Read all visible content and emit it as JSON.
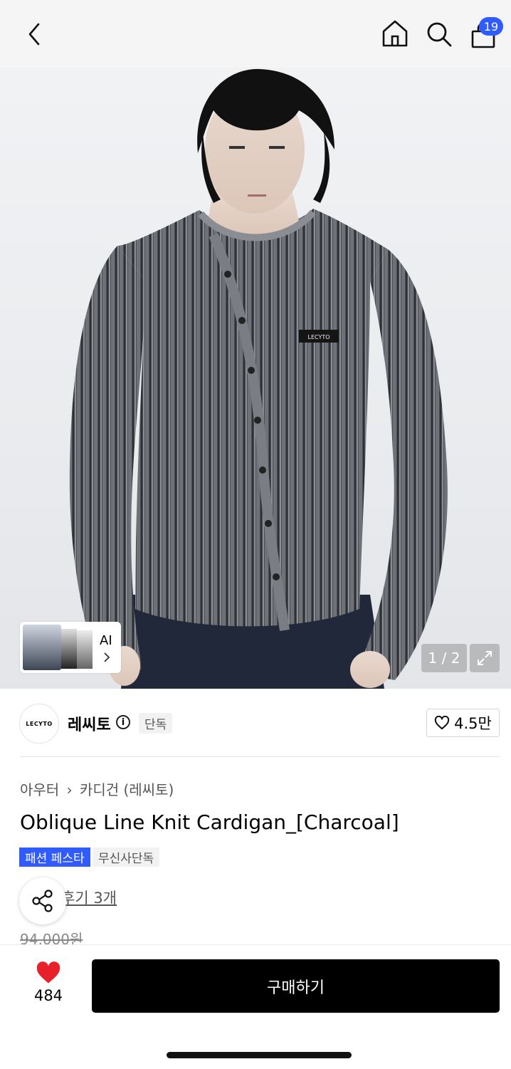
{
  "header": {
    "cart_count": "19"
  },
  "gallery": {
    "ai_label": "AI",
    "counter": "1 / 2",
    "sweater_logo": "LECYTO"
  },
  "brand": {
    "logo_text": "LECYTO",
    "name": "레씨토",
    "exclusive_label": "단독",
    "like_count": "4.5만"
  },
  "product": {
    "breadcrumb_parent": "아우터",
    "breadcrumb_child": "카디건 (레씨토)",
    "title": "Oblique Line Knit Cardigan_[Charcoal]",
    "tag_festa": "패션 페스타",
    "tag_only": "무신사단독",
    "review_text": "후기 3개",
    "original_price": "94,000원"
  },
  "bottom": {
    "heart_count": "484",
    "buy_label": "구매하기"
  },
  "colors": {
    "accent_blue": "#2f5bff",
    "heart_red": "#e8202a",
    "buy_button": "#000000"
  }
}
